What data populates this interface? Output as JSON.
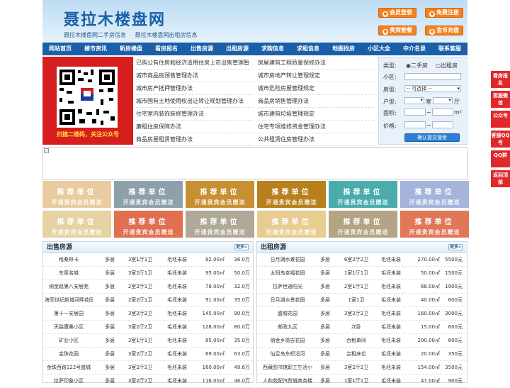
{
  "header": {
    "title": "聂拉木楼盘网",
    "sublinks": [
      "聂拉木楼盘网二手房信息",
      "聂拉木楼盘网出租房信息"
    ],
    "buttons": [
      "会员登录",
      "免费注册",
      "贵宾套餐",
      "金币充值"
    ]
  },
  "nav": [
    "网站首页",
    "楼市资讯",
    "新房楼盘",
    "看房报名",
    "出售房源",
    "出租房源",
    "求购信息",
    "求租信息",
    "地图找房",
    "小区大全",
    "中介名录",
    "联系客服"
  ],
  "qr": {
    "caption": "扫描二维码，关注公众号"
  },
  "news_left": [
    "已购公有住房和经济适用住房上市出售管理暂",
    "城市商品房预售管理办法",
    "城市房产抵押管理办法",
    "城市国有土地使用权出让转让规划管理办法",
    "住宅室内装饰装修管理办法",
    "廉租住房保障办法",
    "商品房屋租赁管理办法"
  ],
  "news_right": [
    "房屋建筑工程质量保修办法",
    "城市房地产转让管理规定",
    "城市危险房屋管理规定",
    "商品房销售管理办法",
    "城市建筑垃圾管理规定",
    "住宅专项维修资金管理办法",
    "公共租赁住房管理办法"
  ],
  "search": {
    "category_label": "类型:",
    "opt1": "二手房",
    "opt2": "出租房",
    "community_label": "小区:",
    "type_label": "房型:",
    "type_value": "-- 可选择 --",
    "layout_label": "户型:",
    "room_unit": "室",
    "hall_unit": "厅",
    "area_label": "面积:",
    "area_unit": "m²",
    "price_label": "价格:",
    "tilde": "~",
    "submit": "确认提交搜索"
  },
  "ads": {
    "line1": "推荐单位",
    "line2": "开通贵宾会员赠送"
  },
  "colors": [
    "#e8ccA0",
    "#8ea0ac",
    "#c89030",
    "#b8801c",
    "#4aacac",
    "#a4b4dc",
    "#e6d2a2",
    "#e07050",
    "#b0a898",
    "#e8cc90",
    "#b4a484",
    "#e07858"
  ],
  "sale": {
    "title": "出售房源",
    "more": "更多»",
    "rows": [
      [
        "格桑林卡",
        "多层",
        "3室1厅1卫",
        "毛坯未装",
        "82.00㎡",
        "36.0万"
      ],
      [
        "东厚名城",
        "多层",
        "3室2厅1卫",
        "毛坯未装",
        "95.00㎡",
        "50.0万"
      ],
      [
        "纳金路第八安居苑",
        "多层",
        "2室2厅1卫",
        "毛坯未装",
        "78.00㎡",
        "32.0万"
      ],
      [
        "海亮世纪新城河畔花园",
        "多层",
        "2室2厅1卫",
        "毛坯未装",
        "91.00㎡",
        "35.0万"
      ],
      [
        "第十一安居园",
        "多层",
        "3室2厅2卫",
        "毛坯未装",
        "145.00㎡",
        "90.0万"
      ],
      [
        "天路康桑小区",
        "多层",
        "3室2厅2卫",
        "毛坯未装",
        "128.00㎡",
        "80.0万"
      ],
      [
        "矿业小区",
        "多层",
        "3室1厅1卫",
        "毛坯未装",
        "85.00㎡",
        "35.0万"
      ],
      [
        "金珠花园",
        "多层",
        "3室2厅2卫",
        "毛坯未装",
        "69.00㎡",
        "63.0万"
      ],
      [
        "金珠西路122号盛城",
        "多层",
        "3室2厅2卫",
        "毛坯未装",
        "160.00㎡",
        "49.6万"
      ],
      [
        "拉萨印象小区",
        "多层",
        "3室2厅2卫",
        "毛坯未装",
        "116.00㎡",
        "46.0万"
      ]
    ]
  },
  "rent": {
    "title": "出租房源",
    "more": "更多»",
    "rows": [
      [
        "日月湖水景花园",
        "多层",
        "6室2厅2卫",
        "毛坯未装",
        "270.00㎡",
        "5500元"
      ],
      [
        "太阳岛幸福花园",
        "多层",
        "1室1厅1卫",
        "毛坯未装",
        "50.00㎡",
        "1500元"
      ],
      [
        "拉萨世通阳光",
        "多层",
        "2室1厅1卫",
        "毛坯未装",
        "68.00㎡",
        "1900元"
      ],
      [
        "日月湖水景花园",
        "多层",
        "1室1卫",
        "毛坯未装",
        "40.00㎡",
        "600元"
      ],
      [
        "盛城花园",
        "多层",
        "3室2厅2卫",
        "毛坯未装",
        "160.00㎡",
        "3000元"
      ],
      [
        "邮政九区",
        "多层",
        "次卧",
        "毛坯未装",
        "15.00㎡",
        "600元"
      ],
      [
        "纳金乡德吉花园",
        "多层",
        "合租单间",
        "毛坯未装",
        "200.00㎡",
        "600元"
      ],
      [
        "仙足岛东桥沿河",
        "多层",
        "合租床位",
        "毛坯未装",
        "20.00㎡",
        "350元"
      ],
      [
        "西藏图书馆职工生活小",
        "多层",
        "3室2厅2卫",
        "毛坯未装",
        "154.00㎡",
        "3500元"
      ],
      [
        "人和苑配汽贸城商务楼",
        "多层",
        "1室1厅1卫",
        "毛坯未装",
        "47.00㎡",
        "900元"
      ]
    ]
  },
  "sidebar": [
    "看房报名",
    "客服微信",
    "公众号",
    "客服QQ号",
    "QQ群",
    "返回顶部"
  ]
}
